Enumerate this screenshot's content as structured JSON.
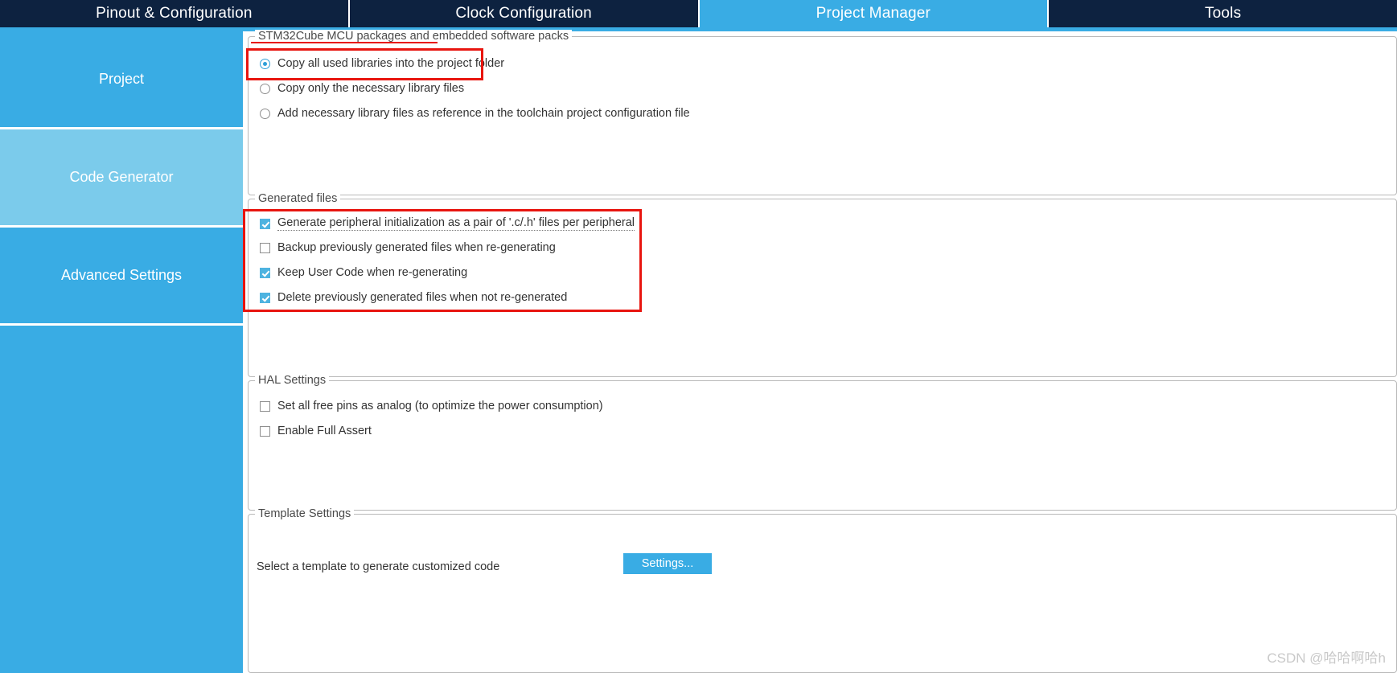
{
  "window": {
    "app": "STM32CubeMX Project Manager"
  },
  "tabs": [
    {
      "label": "Pinout & Configuration",
      "active": false
    },
    {
      "label": "Clock Configuration",
      "active": false
    },
    {
      "label": "Project Manager",
      "active": true
    },
    {
      "label": "Tools",
      "active": false
    }
  ],
  "sidebar": {
    "items": [
      {
        "label": "Project",
        "selected": false
      },
      {
        "label": "Code Generator",
        "selected": true
      },
      {
        "label": "Advanced Settings",
        "selected": false
      }
    ]
  },
  "groups": {
    "packages": {
      "legend": "STM32Cube MCU packages and embedded software packs",
      "options": [
        {
          "label": "Copy all used libraries into the project folder",
          "checked": true
        },
        {
          "label": "Copy only the necessary library files",
          "checked": false
        },
        {
          "label": "Add necessary library files as reference in the toolchain project configuration file",
          "checked": false
        }
      ]
    },
    "generated_files": {
      "legend": "Generated files",
      "options": [
        {
          "label": "Generate peripheral initialization as a pair of '.c/.h' files per peripheral",
          "checked": true,
          "focused": true
        },
        {
          "label": "Backup previously generated files when re-generating",
          "checked": false,
          "focused": false
        },
        {
          "label": "Keep User Code when re-generating",
          "checked": true,
          "focused": false
        },
        {
          "label": "Delete previously generated files when not re-generated",
          "checked": true,
          "focused": false
        }
      ]
    },
    "hal_settings": {
      "legend": "HAL Settings",
      "options": [
        {
          "label": "Set all free pins as analog (to optimize the power consumption)",
          "checked": false
        },
        {
          "label": "Enable Full Assert",
          "checked": false
        }
      ]
    },
    "template_settings": {
      "legend": "Template Settings",
      "description": "Select a template to generate customized code",
      "settings_button": "Settings..."
    }
  },
  "annotations": {
    "accent_color": "#e8150f",
    "boxes": [
      {
        "target": "copy-all-used-libraries-option"
      },
      {
        "target": "generated-files-checkbox-list"
      }
    ]
  },
  "watermark": {
    "text": "CSDN @哈哈啊哈h"
  },
  "colors": {
    "tabbar_bg": "#0d2240",
    "active_tab": "#39ace4",
    "sidebar": "#39ace4",
    "sidebar_selected": "#7bcbeb",
    "button": "#39ace4",
    "annotation": "#e8150f"
  }
}
